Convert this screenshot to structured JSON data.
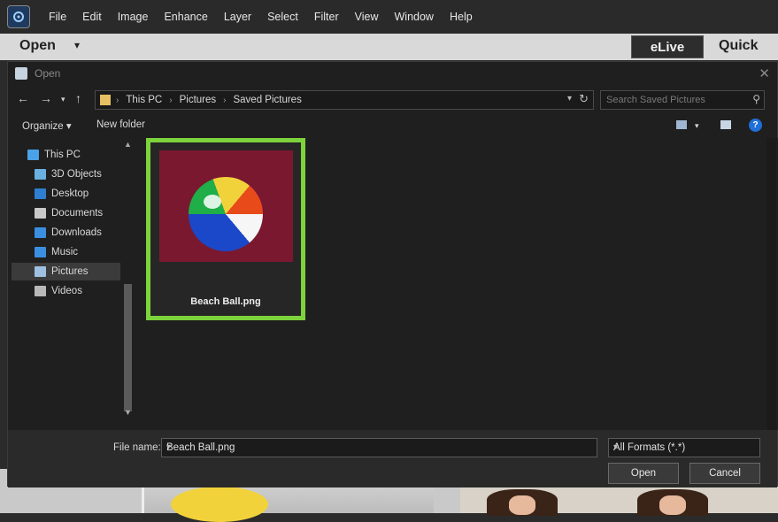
{
  "app": {
    "menu": [
      "File",
      "Edit",
      "Image",
      "Enhance",
      "Layer",
      "Select",
      "Filter",
      "View",
      "Window",
      "Help"
    ],
    "toolbar": {
      "open_label": "Open",
      "elive_label": "eLive",
      "quick_label": "Quick"
    }
  },
  "dialog": {
    "title": "Open",
    "breadcrumb": [
      "This PC",
      "Pictures",
      "Saved Pictures"
    ],
    "search_placeholder": "Search Saved Pictures",
    "organize_label": "Organize ▾",
    "new_folder_label": "New folder",
    "nav_items": [
      {
        "label": "This PC",
        "icon": "computer-icon",
        "color": "#4aa3e8"
      },
      {
        "label": "3D Objects",
        "icon": "cube-icon",
        "color": "#6ab0e0"
      },
      {
        "label": "Desktop",
        "icon": "desktop-icon",
        "color": "#2f7fd0"
      },
      {
        "label": "Documents",
        "icon": "document-icon",
        "color": "#c9c9c9"
      },
      {
        "label": "Downloads",
        "icon": "download-icon",
        "color": "#3b8fe0"
      },
      {
        "label": "Music",
        "icon": "music-icon",
        "color": "#3b8fe0"
      },
      {
        "label": "Pictures",
        "icon": "pictures-icon",
        "color": "#9fc0e0",
        "selected": true
      },
      {
        "label": "Videos",
        "icon": "videos-icon",
        "color": "#b8b8b8"
      }
    ],
    "file": {
      "name": "Beach Ball.png",
      "highlight_color": "#7dd33c",
      "thumb_bg": "#7a1830"
    },
    "footer": {
      "file_name_label": "File name:",
      "file_name_value": "Beach Ball.png",
      "filter_value": "All Formats (*.*)",
      "open_button": "Open",
      "cancel_button": "Cancel"
    }
  }
}
